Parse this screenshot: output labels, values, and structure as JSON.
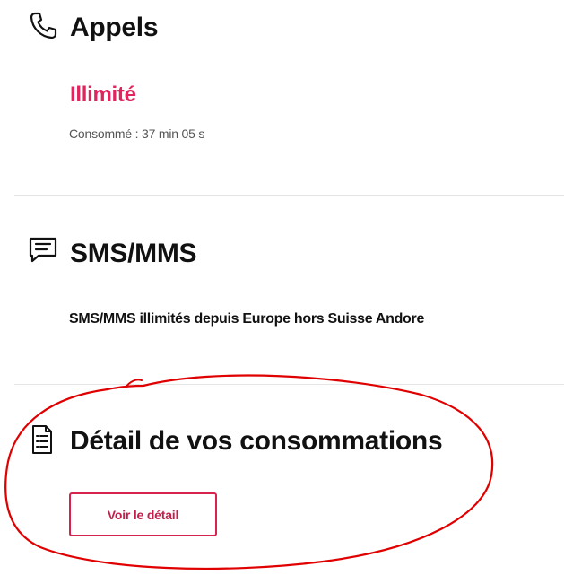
{
  "calls": {
    "title": "Appels",
    "icon": "phone-icon",
    "status": "Illimité",
    "consumed": "Consommé : 37 min 05 s"
  },
  "sms": {
    "title": "SMS/MMS",
    "icon": "message-icon",
    "description": "SMS/MMS illimités depuis Europe hors Suisse Andore"
  },
  "detail": {
    "title": "Détail de vos consommations",
    "icon": "document-list-icon",
    "button_label": "Voir le détail"
  },
  "colors": {
    "accent": "#e0245e",
    "annotation": "#e00000"
  }
}
